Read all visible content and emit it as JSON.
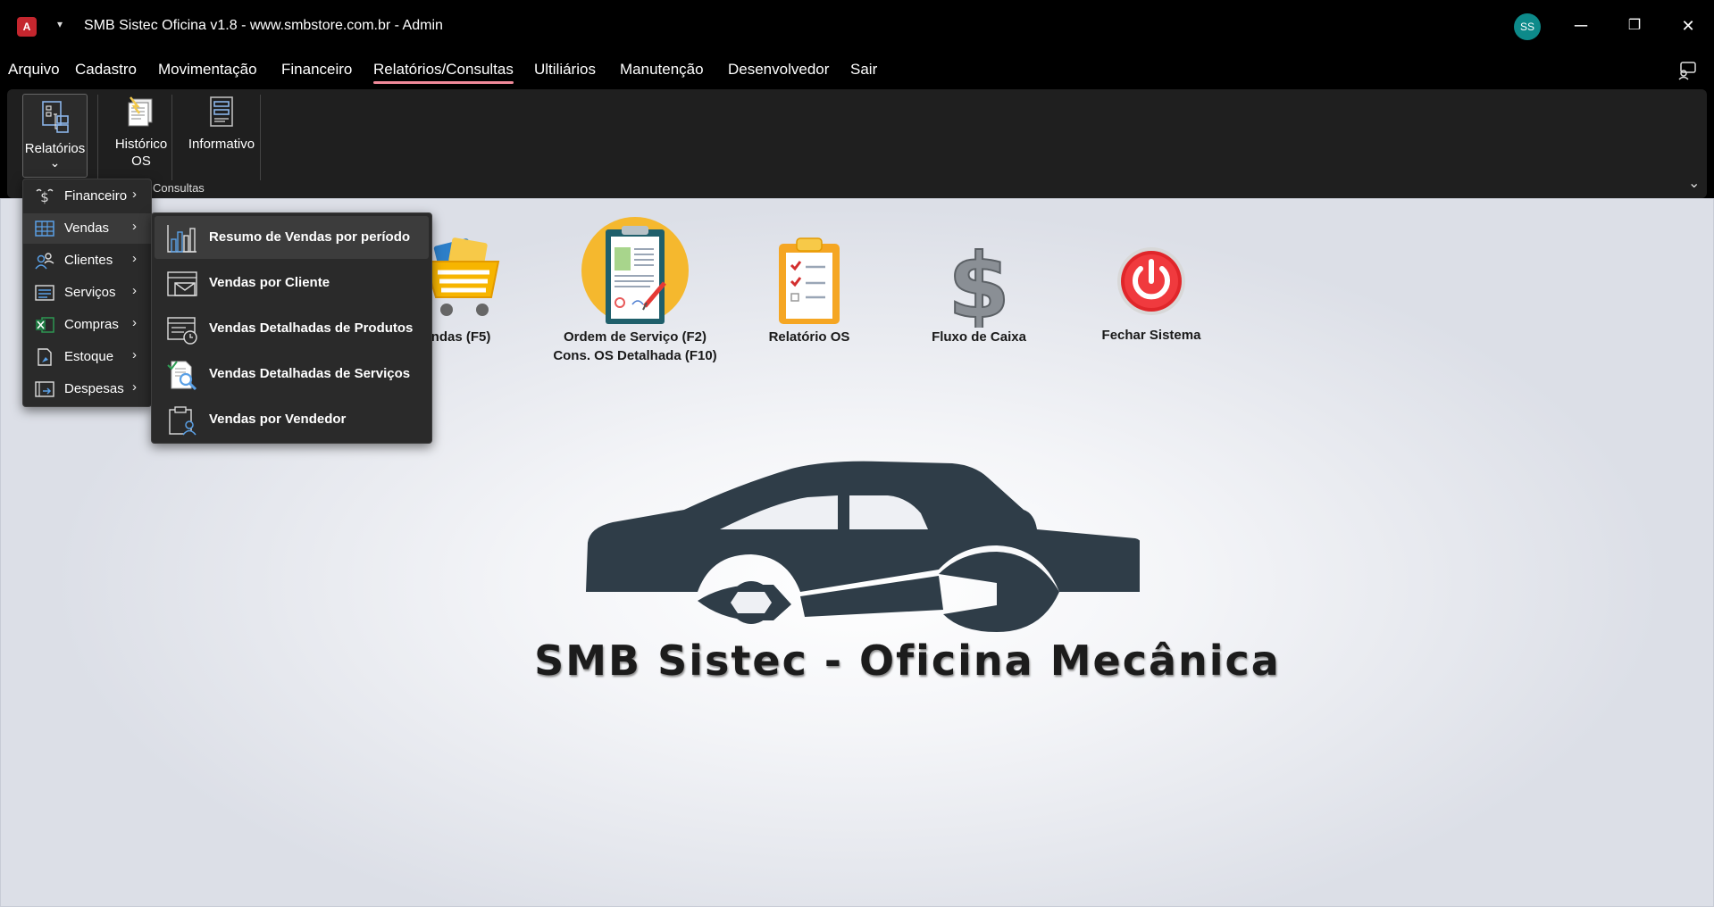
{
  "window": {
    "title": "SMB Sistec Oficina v1.8 - www.smbstore.com.br - Admin",
    "app_icon_letter": "A",
    "qat_symbol": "▾",
    "avatar_initials": "SS",
    "minimize": "─",
    "restore": "❐",
    "close": "✕"
  },
  "menubar": {
    "items": [
      "Arquivo",
      "Cadastro",
      "Movimentação",
      "Financeiro",
      "Relatórios/Consultas",
      "Ultiliários",
      "Manutenção",
      "Desenvolvedor",
      "Sair"
    ],
    "active": "Relatórios/Consultas"
  },
  "ribbon": {
    "relatorios_label": "Relatórios",
    "relatorios_chevron": "⌄",
    "historico_line1": "Histórico",
    "historico_line2": "OS",
    "informativo_label": "Informativo",
    "group_label": "Consultas",
    "collapse_symbol": "⌄"
  },
  "submenu_relatorios": {
    "items": [
      {
        "label": "Financeiro",
        "icon": "currency-icon"
      },
      {
        "label": "Vendas",
        "icon": "grid-table-icon"
      },
      {
        "label": "Clientes",
        "icon": "people-icon"
      },
      {
        "label": "Serviços",
        "icon": "list-doc-icon"
      },
      {
        "label": "Compras",
        "icon": "excel-icon"
      },
      {
        "label": "Estoque",
        "icon": "doc-pin-icon"
      },
      {
        "label": "Despesas",
        "icon": "doc-arrow-icon"
      }
    ],
    "arrow": "›",
    "hovered": "Vendas"
  },
  "submenu_vendas": {
    "items": [
      {
        "label": "Resumo de Vendas por período",
        "icon": "bar-chart-icon"
      },
      {
        "label": "Vendas por Cliente",
        "icon": "envelope-icon"
      },
      {
        "label": "Vendas Detalhadas de Produtos",
        "icon": "list-clock-icon"
      },
      {
        "label": "Vendas Detalhadas de Serviços",
        "icon": "doc-search-icon"
      },
      {
        "label": "Vendas por Vendedor",
        "icon": "clipboard-user-icon"
      }
    ],
    "hovered": "Resumo de Vendas por período"
  },
  "tiles": {
    "vendas": "ndas (F5)",
    "os_line1": "Ordem de Serviço (F2)",
    "os_line2": "Cons. OS Detalhada (F10)",
    "relatorio_os": "Relatório OS",
    "fluxo_caixa": "Fluxo de Caixa",
    "fechar": "Fechar Sistema"
  },
  "banner": {
    "title": "SMB Sistec - Oficina Mecânica"
  },
  "colors": {
    "accent_underline": "#f08a9a",
    "avatar_bg": "#0d8a8a",
    "app_icon_bg": "#c4262e",
    "car_logo": "#2f3d48"
  }
}
